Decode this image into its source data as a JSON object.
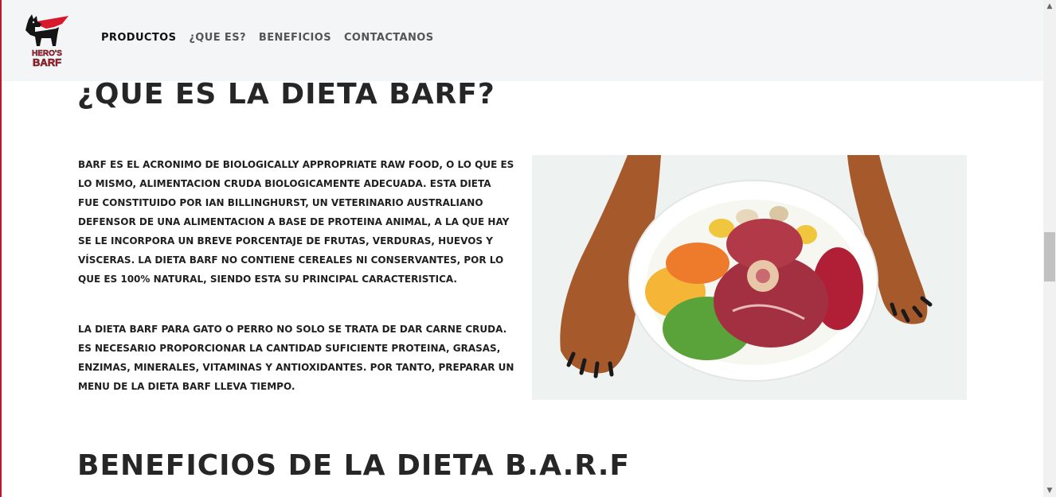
{
  "nav": {
    "logo_alt": "HERO'S BARF",
    "links": [
      "PRODUCTOS",
      "¿QUE ES?",
      "BENEFICIOS",
      "CONTACTANOS"
    ]
  },
  "main": {
    "title": "¿QUE ES LA DIETA BARF?",
    "paragraph1": "BARF es el acronimo de Biologically Appropriate Raw Food, o lo que es lo mismo, alimentacion cruda biologicamente adecuada. Esta dieta fue constituido por Ian Billinghurst, un veterinario australiano defensor de una alimentacion a base de proteina animal, a la que hay se le incorpora un breve porcentaje de frutas, verduras, huevos y vísceras. La dieta BARF no contiene cereales ni conservantes, por lo que es 100% natural, siendo esta su principal caracteristica.",
    "paragraph2": "La dieta BARF para gato o perro no solo se trata de dar carne cruda. Es necesario proporcionar la cantidad suficiente proteina, grasas, enzimas, minerales, vitaminas y antioxidantes. Por tanto, preparar un menu de la dieta BARF lleva tiempo.",
    "section_title": "BENEFICIOS DE LA DIETA B.A.R.F"
  },
  "colors": {
    "brand_red": "#d8182b",
    "navbar_bg": "#f4f5f7"
  }
}
